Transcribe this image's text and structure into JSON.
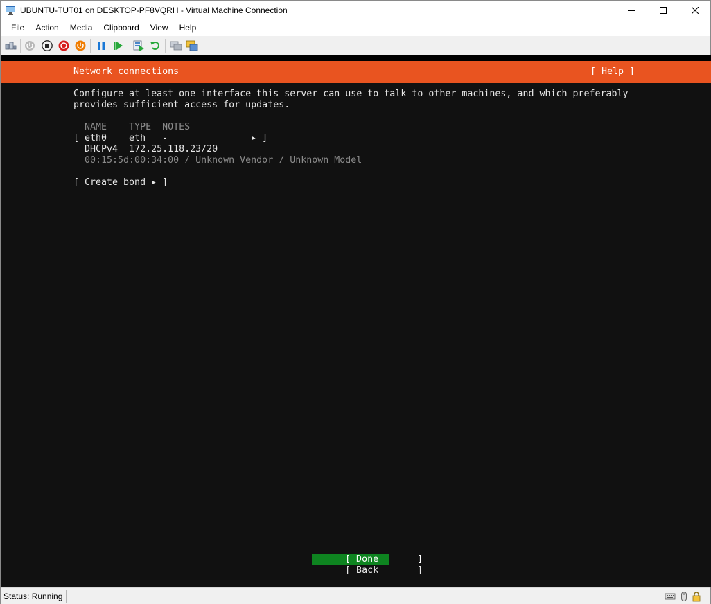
{
  "window": {
    "title": "UBUNTU-TUT01 on DESKTOP-PF8VQRH - Virtual Machine Connection"
  },
  "menu": [
    "File",
    "Action",
    "Media",
    "Clipboard",
    "View",
    "Help"
  ],
  "toolbar_icons": [
    "ctrl-alt-del-icon",
    "start-icon",
    "turn-off-icon",
    "shutdown-icon",
    "save-icon",
    "pause-icon",
    "resume-icon",
    "checkpoint-icon",
    "revert-icon",
    "enhanced-session-icon",
    "share-icon"
  ],
  "console": {
    "header_title": "Network connections",
    "help_label": "[ Help ]",
    "description_line1": "Configure at least one interface this server can use to talk to other machines, and which preferably",
    "description_line2": "provides sufficient access for updates.",
    "table_header": "  NAME    TYPE  NOTES",
    "interfaces": [
      {
        "row": "[ eth0    eth   -               ▸ ]",
        "address": "  DHCPv4  172.25.118.23/20",
        "hardware": "  00:15:5d:00:34:00 / Unknown Vendor / Unknown Model"
      }
    ],
    "create_bond": "[ Create bond ▸ ]",
    "done_button": "[ Done       ]",
    "back_button": "[ Back       ]"
  },
  "status": {
    "text": "Status: Running"
  },
  "colors": {
    "header": "#e95420",
    "done_button": "#0e8420",
    "console_bg": "#111111"
  }
}
